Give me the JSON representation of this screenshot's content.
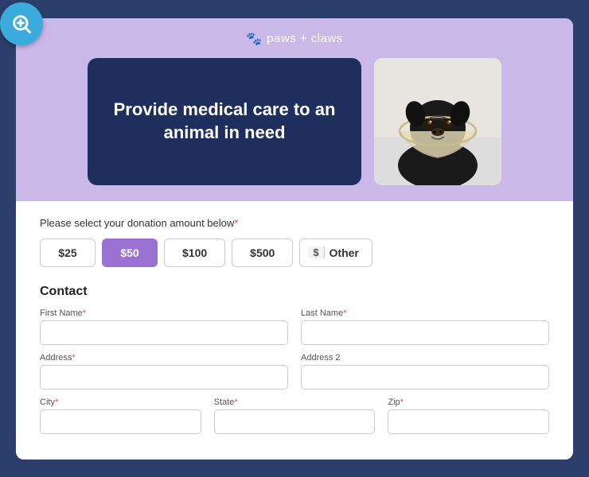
{
  "brand": {
    "name": "paws + claws",
    "icon": "🐾"
  },
  "hero": {
    "headline": "Provide medical care to an animal in need"
  },
  "donation": {
    "label": "Please select your donation amount below",
    "required": true,
    "options": [
      {
        "id": "25",
        "label": "$25",
        "active": false
      },
      {
        "id": "50",
        "label": "$50",
        "active": true
      },
      {
        "id": "100",
        "label": "$100",
        "active": false
      },
      {
        "id": "500",
        "label": "$500",
        "active": false
      },
      {
        "id": "other",
        "label": "Other",
        "active": false
      }
    ],
    "other_prefix": "$"
  },
  "contact": {
    "title": "Contact",
    "fields": [
      {
        "id": "first-name",
        "label": "First Name",
        "required": true,
        "placeholder": ""
      },
      {
        "id": "last-name",
        "label": "Last Name",
        "required": true,
        "placeholder": ""
      },
      {
        "id": "address",
        "label": "Address",
        "required": true,
        "placeholder": ""
      },
      {
        "id": "address2",
        "label": "Address 2",
        "required": false,
        "placeholder": ""
      },
      {
        "id": "city",
        "label": "City",
        "required": true,
        "placeholder": ""
      },
      {
        "id": "state",
        "label": "State",
        "required": true,
        "placeholder": ""
      },
      {
        "id": "zip",
        "label": "Zip",
        "required": true,
        "placeholder": ""
      }
    ]
  },
  "zoom": {
    "label": "zoom-in"
  }
}
